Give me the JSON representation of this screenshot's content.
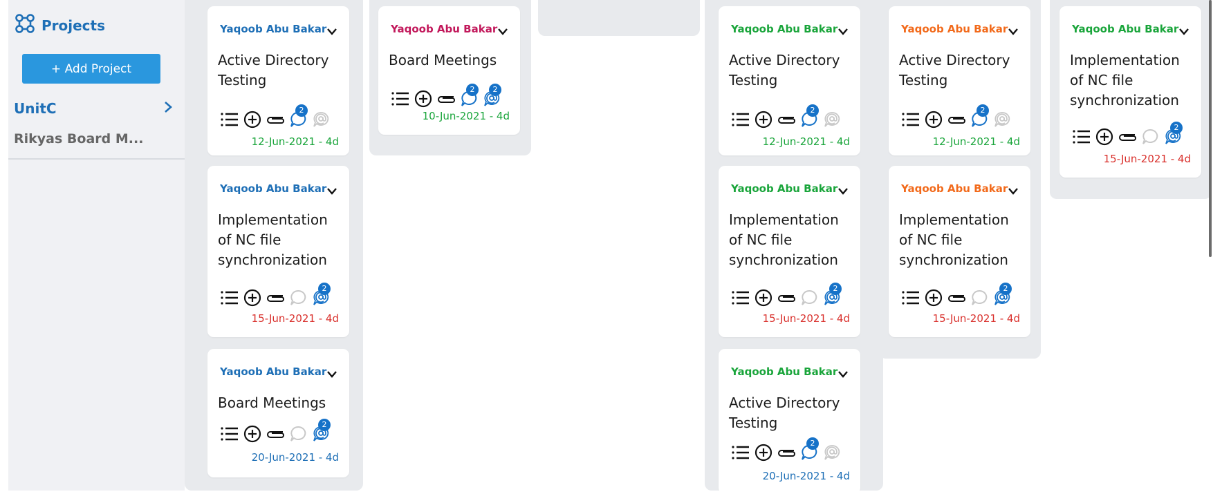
{
  "sidebar": {
    "projects_label": "Projects",
    "add_project_label": "+ Add Project",
    "unit_label": "UnitC",
    "sub_project_label": "Rikyas Board M..."
  },
  "colors": {
    "blue": "#1e6fb6",
    "green": "#1aa53b",
    "pink": "#c2185b",
    "orange": "#f26a1b",
    "red": "#d9302c",
    "badge": "#1672c8"
  },
  "cards": [
    {
      "assignee": "Yaqoob Abu Bakar",
      "assignee_color": "blue",
      "title": "Active Directory Testing",
      "date": "12-Jun-2021 - 4d",
      "date_color": "green",
      "comment_badge": "2",
      "mention_badge": "",
      "comment_active": true,
      "mention_active": false
    },
    {
      "assignee": "Yaqoob Abu Bakar",
      "assignee_color": "blue",
      "title": "Implementation of NC file synchronization",
      "date": "15-Jun-2021 - 4d",
      "date_color": "red",
      "comment_badge": "",
      "mention_badge": "2",
      "comment_active": false,
      "mention_active": true
    },
    {
      "assignee": "Yaqoob Abu Bakar",
      "assignee_color": "blue",
      "title": "Board Meetings",
      "date": "20-Jun-2021 - 4d",
      "date_color": "blue",
      "comment_badge": "",
      "mention_badge": "2",
      "comment_active": false,
      "mention_active": true
    },
    {
      "assignee": "Yaqoob Abu Bakar",
      "assignee_color": "pink",
      "title": "Board Meetings",
      "date": "10-Jun-2021 - 4d",
      "date_color": "green",
      "comment_badge": "2",
      "mention_badge": "2",
      "comment_active": true,
      "mention_active": true
    },
    {
      "assignee": "Yaqoob Abu Bakar",
      "assignee_color": "green",
      "title": "Active Directory Testing",
      "date": "12-Jun-2021 - 4d",
      "date_color": "green",
      "comment_badge": "2",
      "mention_badge": "",
      "comment_active": true,
      "mention_active": false
    },
    {
      "assignee": "Yaqoob Abu Bakar",
      "assignee_color": "green",
      "title": "Implementation of NC file synchronization",
      "date": "15-Jun-2021 - 4d",
      "date_color": "red",
      "comment_badge": "",
      "mention_badge": "2",
      "comment_active": false,
      "mention_active": true
    },
    {
      "assignee": "Yaqoob Abu Bakar",
      "assignee_color": "green",
      "title": "Active Directory Testing",
      "date": "20-Jun-2021 - 4d",
      "date_color": "blue",
      "comment_badge": "2",
      "mention_badge": "",
      "comment_active": true,
      "mention_active": false
    },
    {
      "assignee": "Yaqoob Abu Bakar",
      "assignee_color": "orange",
      "title": "Active Directory Testing",
      "date": "12-Jun-2021 - 4d",
      "date_color": "green",
      "comment_badge": "2",
      "mention_badge": "",
      "comment_active": true,
      "mention_active": false
    },
    {
      "assignee": "Yaqoob Abu Bakar",
      "assignee_color": "orange",
      "title": "Implementation of NC file synchronization",
      "date": "15-Jun-2021 - 4d",
      "date_color": "red",
      "comment_badge": "",
      "mention_badge": "2",
      "comment_active": false,
      "mention_active": true
    },
    {
      "assignee": "Yaqoob Abu Bakar",
      "assignee_color": "green",
      "title": "Implementation of NC file synchronization",
      "date": "15-Jun-2021 - 4d",
      "date_color": "red",
      "comment_badge": "",
      "mention_badge": "2",
      "comment_active": false,
      "mention_active": true
    }
  ]
}
